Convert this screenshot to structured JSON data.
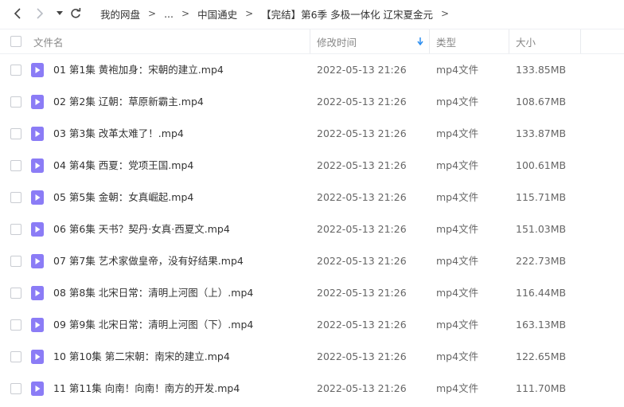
{
  "nav": {
    "back_icon": "chevron-left-icon",
    "forward_icon": "chevron-right-icon",
    "history_icon": "caret-down-icon",
    "refresh_icon": "refresh-icon"
  },
  "breadcrumb": {
    "items": [
      "我的网盘",
      "...",
      "中国通史",
      "【完结】第6季 多极一体化 辽宋夏金元"
    ],
    "separator": ">"
  },
  "header": {
    "name_label": "文件名",
    "date_label": "修改时间",
    "type_label": "类型",
    "size_label": "大小",
    "sort_icon": "sort-down-arrow-icon"
  },
  "colors": {
    "file_icon": "#8b7cf6",
    "sort_arrow": "#2e8ff0"
  },
  "files": [
    {
      "name": "01 第1集 黄袍加身：宋朝的建立.mp4",
      "date": "2022-05-13 21:26",
      "type": "mp4文件",
      "size": "133.85MB"
    },
    {
      "name": "02 第2集 辽朝：草原新霸主.mp4",
      "date": "2022-05-13 21:26",
      "type": "mp4文件",
      "size": "108.67MB"
    },
    {
      "name": "03 第3集 改革太难了！.mp4",
      "date": "2022-05-13 21:26",
      "type": "mp4文件",
      "size": "133.87MB"
    },
    {
      "name": "04 第4集 西夏：党项王国.mp4",
      "date": "2022-05-13 21:26",
      "type": "mp4文件",
      "size": "100.61MB"
    },
    {
      "name": "05 第5集 金朝：女真崛起.mp4",
      "date": "2022-05-13 21:26",
      "type": "mp4文件",
      "size": "115.71MB"
    },
    {
      "name": "06 第6集 天书？契丹·女真·西夏文.mp4",
      "date": "2022-05-13 21:26",
      "type": "mp4文件",
      "size": "151.03MB"
    },
    {
      "name": "07 第7集 艺术家做皇帝，没有好结果.mp4",
      "date": "2022-05-13 21:26",
      "type": "mp4文件",
      "size": "222.73MB"
    },
    {
      "name": "08 第8集 北宋日常：清明上河图（上）.mp4",
      "date": "2022-05-13 21:26",
      "type": "mp4文件",
      "size": "116.44MB"
    },
    {
      "name": "09 第9集 北宋日常：清明上河图（下）.mp4",
      "date": "2022-05-13 21:26",
      "type": "mp4文件",
      "size": "163.13MB"
    },
    {
      "name": "10 第10集 第二宋朝：南宋的建立.mp4",
      "date": "2022-05-13 21:26",
      "type": "mp4文件",
      "size": "122.65MB"
    },
    {
      "name": "11 第11集 向南！向南！南方的开发.mp4",
      "date": "2022-05-13 21:26",
      "type": "mp4文件",
      "size": "111.70MB"
    }
  ]
}
